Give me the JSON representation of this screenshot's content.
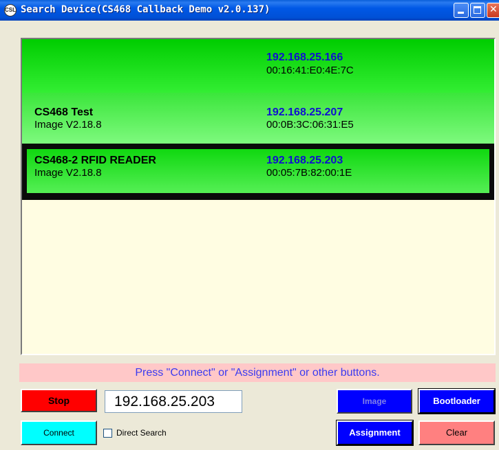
{
  "window": {
    "title": "Search Device(CS468 Callback Demo v2.0.137)",
    "icon_label": "CSL"
  },
  "devices": [
    {
      "name": "",
      "version": "",
      "ip": "192.168.25.166",
      "mac": "00:16:41:E0:4E:7C"
    },
    {
      "name": "CS468 Test",
      "version": "Image V2.18.8",
      "ip": "192.168.25.207",
      "mac": "00:0B:3C:06:31:E5"
    },
    {
      "name": "CS468-2 RFID READER",
      "version": "Image V2.18.8",
      "ip": "192.168.25.203",
      "mac": "00:05:7B:82:00:1E",
      "selected": true
    }
  ],
  "status_message": "Press \"Connect\" or \"Assignment\" or other buttons.",
  "controls": {
    "stop_label": "Stop",
    "ip_value": "192.168.25.203",
    "connect_label": "Connect",
    "direct_search_label": "Direct Search",
    "direct_search_checked": false,
    "image_label": "Image",
    "bootloader_label": "Bootloader",
    "assignment_label": "Assignment",
    "clear_label": "Clear"
  },
  "colors": {
    "list_background": "#fffde2",
    "row_green": "#00cd00",
    "ip_text": "#1010d0",
    "status_background": "#ffc8c8",
    "stop": "#ff0000",
    "connect": "#00ffff",
    "blue_button": "#0000ff",
    "clear": "#ff8080"
  }
}
